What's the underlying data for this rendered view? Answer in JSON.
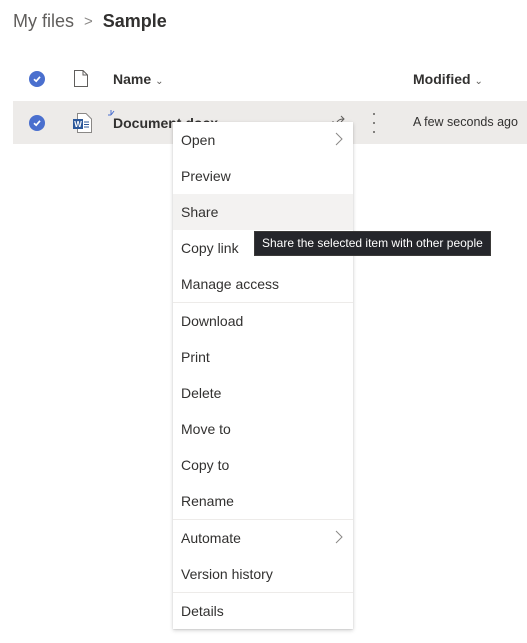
{
  "breadcrumb": {
    "root": "My files",
    "separator": ">",
    "current": "Sample"
  },
  "list_header": {
    "select_all_icon": "checkmark-circle-icon",
    "file_type_icon": "document-icon",
    "name_label": "Name",
    "modified_label": "Modified",
    "sort_icon": "chevron-down-icon"
  },
  "file_row": {
    "selected": true,
    "icon": "word-document-icon",
    "name": "Document.docx",
    "modified": "A few seconds ago",
    "share_icon": "share-icon",
    "more_icon": "more-vertical-icon"
  },
  "context_menu": {
    "groups": [
      [
        {
          "label": "Open",
          "submenu": true
        },
        {
          "label": "Preview",
          "submenu": false
        },
        {
          "label": "Share",
          "submenu": false,
          "hovered": true
        },
        {
          "label": "Copy link",
          "submenu": false
        },
        {
          "label": "Manage access",
          "submenu": false
        }
      ],
      [
        {
          "label": "Download",
          "submenu": false
        },
        {
          "label": "Print",
          "submenu": false
        },
        {
          "label": "Delete",
          "submenu": false
        },
        {
          "label": "Move to",
          "submenu": false
        },
        {
          "label": "Copy to",
          "submenu": false
        },
        {
          "label": "Rename",
          "submenu": false
        }
      ],
      [
        {
          "label": "Automate",
          "submenu": true
        },
        {
          "label": "Version history",
          "submenu": false
        }
      ],
      [
        {
          "label": "Details",
          "submenu": false
        }
      ]
    ]
  },
  "tooltip": {
    "text": "Share the selected item with other people"
  },
  "colors": {
    "accent": "#4a6fce",
    "selected_row": "#edebe9",
    "tooltip_bg": "#25262b"
  }
}
